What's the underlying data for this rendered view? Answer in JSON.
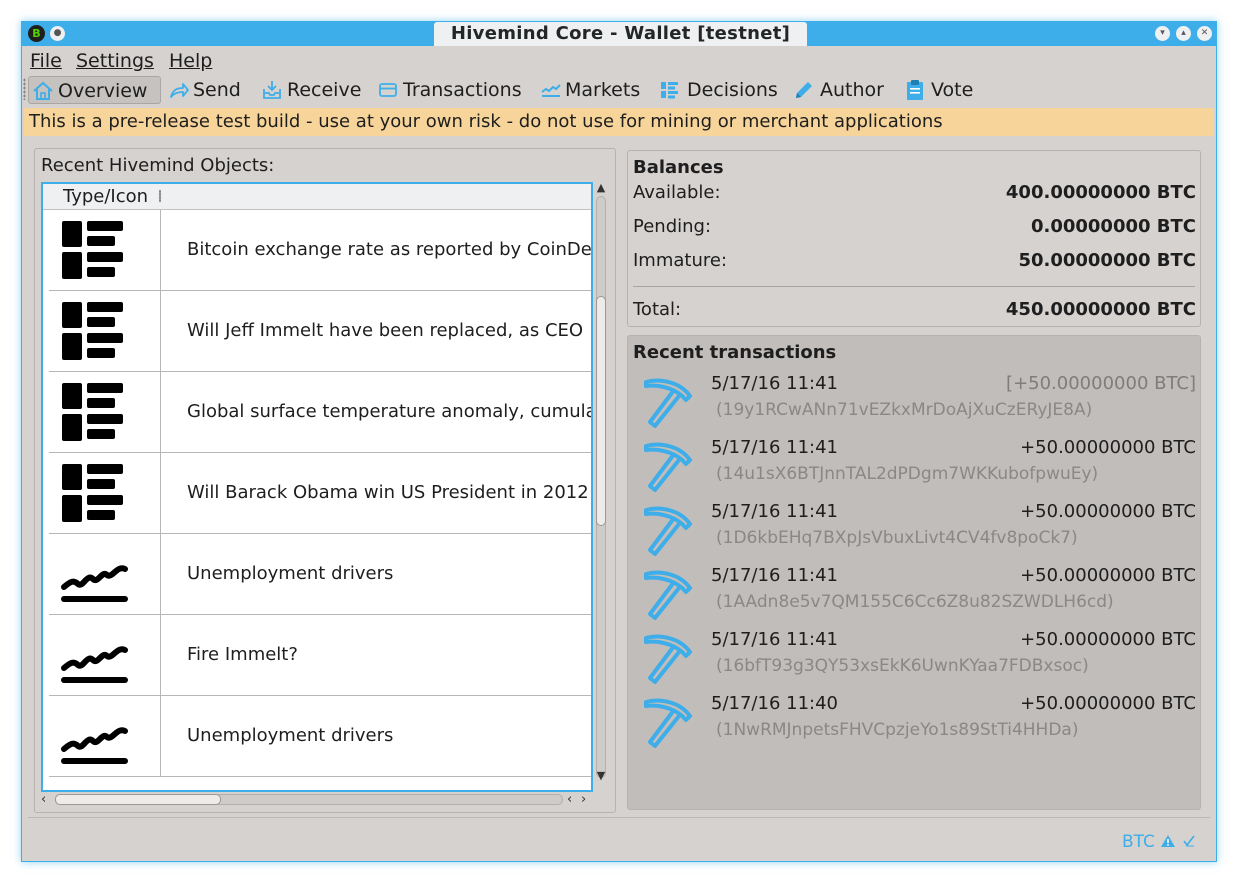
{
  "window": {
    "title": "Hivemind Core - Wallet [testnet]"
  },
  "menu": {
    "file": "File",
    "settings": "Settings",
    "help": "Help"
  },
  "toolbar": {
    "overview": "Overview",
    "send": "Send",
    "receive": "Receive",
    "transactions": "Transactions",
    "markets": "Markets",
    "decisions": "Decisions",
    "author": "Author",
    "vote": "Vote"
  },
  "banner": "This is a pre-release test build - use at your own risk - do not use for mining or merchant applications",
  "objects": {
    "title": "Recent Hivemind Objects:",
    "column_header": "Type/Icon",
    "rows": [
      {
        "type": "decision",
        "text": "Bitcoin exchange rate as reported by CoinDesk"
      },
      {
        "type": "decision",
        "text": "Will Jeff Immelt have been replaced, as CEO"
      },
      {
        "type": "decision",
        "text": "Global surface temperature anomaly, cumulative"
      },
      {
        "type": "decision",
        "text": "Will Barack Obama win US President in 2012"
      },
      {
        "type": "market",
        "text": "Unemployment drivers"
      },
      {
        "type": "market",
        "text": "Fire Immelt?"
      },
      {
        "type": "market",
        "text": "Unemployment drivers"
      }
    ]
  },
  "balances": {
    "title": "Balances",
    "available_label": "Available:",
    "available": "400.00000000 BTC",
    "pending_label": "Pending:",
    "pending": "0.00000000 BTC",
    "immature_label": "Immature:",
    "immature": "50.00000000 BTC",
    "total_label": "Total:",
    "total": "450.00000000 BTC"
  },
  "recent": {
    "title": "Recent transactions",
    "items": [
      {
        "date": "5/17/16 11:41",
        "amount": "[+50.00000000 BTC]",
        "address": "(19y1RCwANn71vEZkxMrDoAjXuCzERyJE8A)"
      },
      {
        "date": "5/17/16 11:41",
        "amount": "+50.00000000 BTC",
        "address": "(14u1sX6BTJnnTAL2dPDgm7WKKubofpwuEy)"
      },
      {
        "date": "5/17/16 11:41",
        "amount": "+50.00000000 BTC",
        "address": "(1D6kbEHq7BXpJsVbuxLivt4CV4fv8poCk7)"
      },
      {
        "date": "5/17/16 11:41",
        "amount": "+50.00000000 BTC",
        "address": "(1AAdn8e5v7QM155C6Cc6Z8u82SZWDLH6cd)"
      },
      {
        "date": "5/17/16 11:41",
        "amount": "+50.00000000 BTC",
        "address": "(16bfT93g3QY53xsEkK6UwnKYaa7FDBxsoc)"
      },
      {
        "date": "5/17/16 11:40",
        "amount": "+50.00000000 BTC",
        "address": "(1NwRMJnpetsFHVCpzjeYo1s89StTi4HHDa)"
      }
    ]
  },
  "status": {
    "unit": "BTC"
  },
  "colors": {
    "accent": "#3daee9",
    "banner": "#f6d49a",
    "window_bg": "#d6d2d0"
  }
}
